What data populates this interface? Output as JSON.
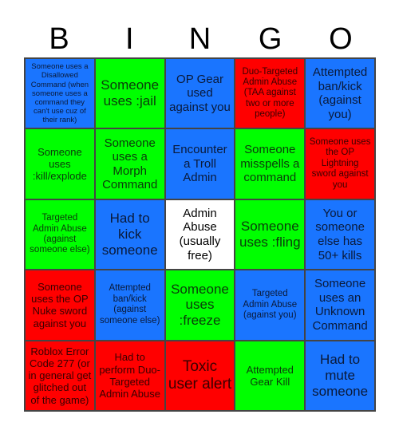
{
  "header": {
    "letters": [
      "B",
      "I",
      "N",
      "G",
      "O"
    ]
  },
  "colors": {
    "blue": "#1a75ff",
    "green": "#00ff00",
    "red": "#ff0000",
    "white": "#ffffff",
    "border": "#444444"
  },
  "board": {
    "rows": [
      [
        {
          "text": "Someone uses a Disallowed Command (when someone uses a command they can't use cuz of their rank)",
          "color": "blue"
        },
        {
          "text": "Someone uses :jail",
          "color": "green"
        },
        {
          "text": "OP Gear used against you",
          "color": "blue"
        },
        {
          "text": "Duo-Targeted Admin Abuse (TAA against two or more people)",
          "color": "red"
        },
        {
          "text": "Attempted ban/kick (against you)",
          "color": "blue"
        }
      ],
      [
        {
          "text": "Someone uses :kill/explode",
          "color": "green"
        },
        {
          "text": "Someone uses a Morph Command",
          "color": "green"
        },
        {
          "text": "Encounter a Troll Admin",
          "color": "blue"
        },
        {
          "text": "Someone misspells a command",
          "color": "green"
        },
        {
          "text": "Someone uses the OP Lightning sword against you",
          "color": "red"
        }
      ],
      [
        {
          "text": "Targeted Admin Abuse (against someone else)",
          "color": "green"
        },
        {
          "text": "Had to kick someone",
          "color": "blue"
        },
        {
          "text": "Admin Abuse (usually free)",
          "color": "white"
        },
        {
          "text": "Someone uses :fling",
          "color": "green"
        },
        {
          "text": "You or someone else has 50+ kills",
          "color": "blue"
        }
      ],
      [
        {
          "text": "Someone uses the OP Nuke sword against you",
          "color": "red"
        },
        {
          "text": "Attempted ban/kick (against someone else)",
          "color": "blue"
        },
        {
          "text": "Someone uses :freeze",
          "color": "green"
        },
        {
          "text": "Targeted Admin Abuse (against you)",
          "color": "blue"
        },
        {
          "text": "Someone uses an Unknown Command",
          "color": "blue"
        }
      ],
      [
        {
          "text": "Roblox Error Code 277 (or in general get glitched out of the game)",
          "color": "red"
        },
        {
          "text": "Had to perform Duo-Targeted Admin Abuse",
          "color": "red"
        },
        {
          "text": "Toxic user alert",
          "color": "red"
        },
        {
          "text": "Attempted Gear Kill",
          "color": "green"
        },
        {
          "text": "Had to mute someone",
          "color": "blue"
        }
      ]
    ]
  }
}
